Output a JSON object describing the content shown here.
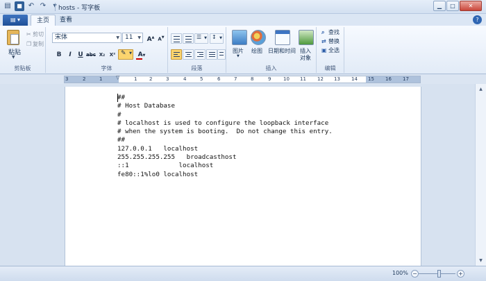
{
  "window": {
    "title": "hosts - 写字板",
    "controls": [
      "minimize-icon",
      "maximize-icon",
      "close-icon"
    ]
  },
  "quick_access": {
    "icons": [
      "save-icon",
      "undo-icon",
      "redo-icon",
      "customize-icon"
    ]
  },
  "tabs": [
    {
      "label": "主页",
      "active": true
    },
    {
      "label": "查看",
      "active": false
    }
  ],
  "ribbon": {
    "clipboard": {
      "group_label": "剪贴板",
      "paste_label": "粘贴",
      "cut_label": "剪切",
      "copy_label": "复制"
    },
    "font": {
      "group_label": "字体",
      "family": "宋体",
      "size": "11",
      "grow_label": "A",
      "shrink_label": "A",
      "format_buttons": [
        "B",
        "I",
        "U",
        "abc",
        "X₂",
        "X²"
      ],
      "color_label": "A",
      "highlight_color": "#f0c000",
      "text_color": "#cc0000"
    },
    "paragraph": {
      "group_label": "段落"
    },
    "insert": {
      "group_label": "插入",
      "picture_label": "图片",
      "paint_label": "绘图",
      "datetime_label": "日期和时间",
      "object_label_1": "插入",
      "object_label_2": "对象"
    },
    "editing": {
      "group_label": "编辑",
      "find_label": "查找",
      "replace_label": "替换",
      "select_all_label": "全选"
    }
  },
  "ruler": {
    "numbers": [
      "3",
      "2",
      "1",
      "1",
      "2",
      "3",
      "4",
      "5",
      "6",
      "7",
      "8",
      "9",
      "10",
      "11",
      "12",
      "13",
      "14",
      "15",
      "16",
      "17"
    ]
  },
  "document": {
    "lines": [
      "##",
      "# Host Database",
      "#",
      "# localhost is used to configure the loopback interface",
      "# when the system is booting.  Do not change this entry.",
      "##",
      "127.0.0.1   localhost",
      "255.255.255.255   broadcasthost",
      "::1             localhost",
      "fe80::1%lo0 localhost"
    ]
  },
  "status": {
    "zoom": "100%",
    "zoom_out": "−",
    "zoom_in": "+"
  },
  "colors": {
    "ribbon_bg": "#e2ebf7",
    "app_menu": "#2a5ea8",
    "document_bg": "#d7e2f0"
  }
}
